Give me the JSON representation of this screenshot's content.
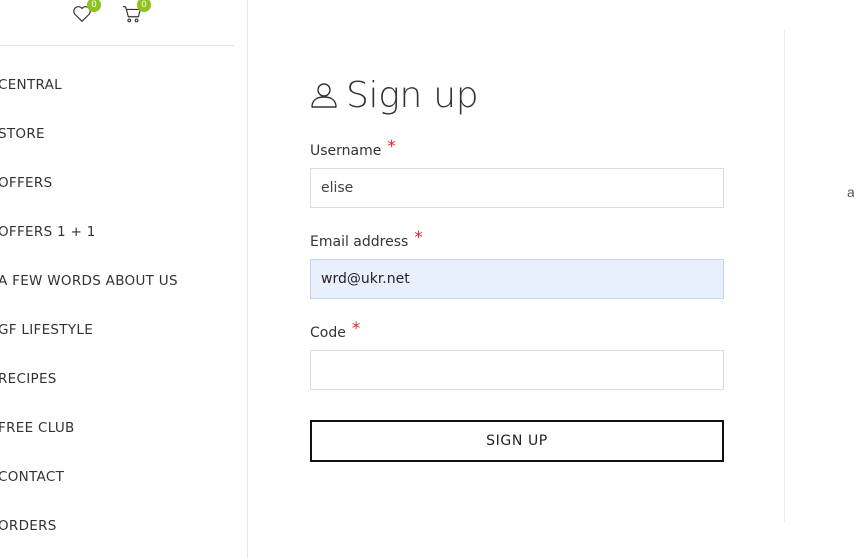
{
  "header": {
    "wishlist_count": "0",
    "cart_count": "0",
    "badge_color": "#8dc21f"
  },
  "sidebar": {
    "items": [
      {
        "label": "CENTRAL"
      },
      {
        "label": "STORE"
      },
      {
        "label": "OFFERS"
      },
      {
        "label": "OFFERS 1 + 1"
      },
      {
        "label": "A FEW WORDS ABOUT US"
      },
      {
        "label": "GF LIFESTYLE"
      },
      {
        "label": "RECIPES"
      },
      {
        "label": "FREE CLUB"
      },
      {
        "label": "CONTACT"
      },
      {
        "label": "ORDERS"
      }
    ]
  },
  "form": {
    "title": "Sign up",
    "required_mark": "*",
    "username": {
      "label": "Username",
      "value": "elise"
    },
    "email": {
      "label": "Email address",
      "value": "wrd@ukr.net"
    },
    "code": {
      "label": "Code",
      "value": ""
    },
    "submit_label": "SIGN UP"
  },
  "right_panel": {
    "text": "a"
  },
  "colors": {
    "required": "#e0262d",
    "autofill": "#e8f0fe"
  }
}
